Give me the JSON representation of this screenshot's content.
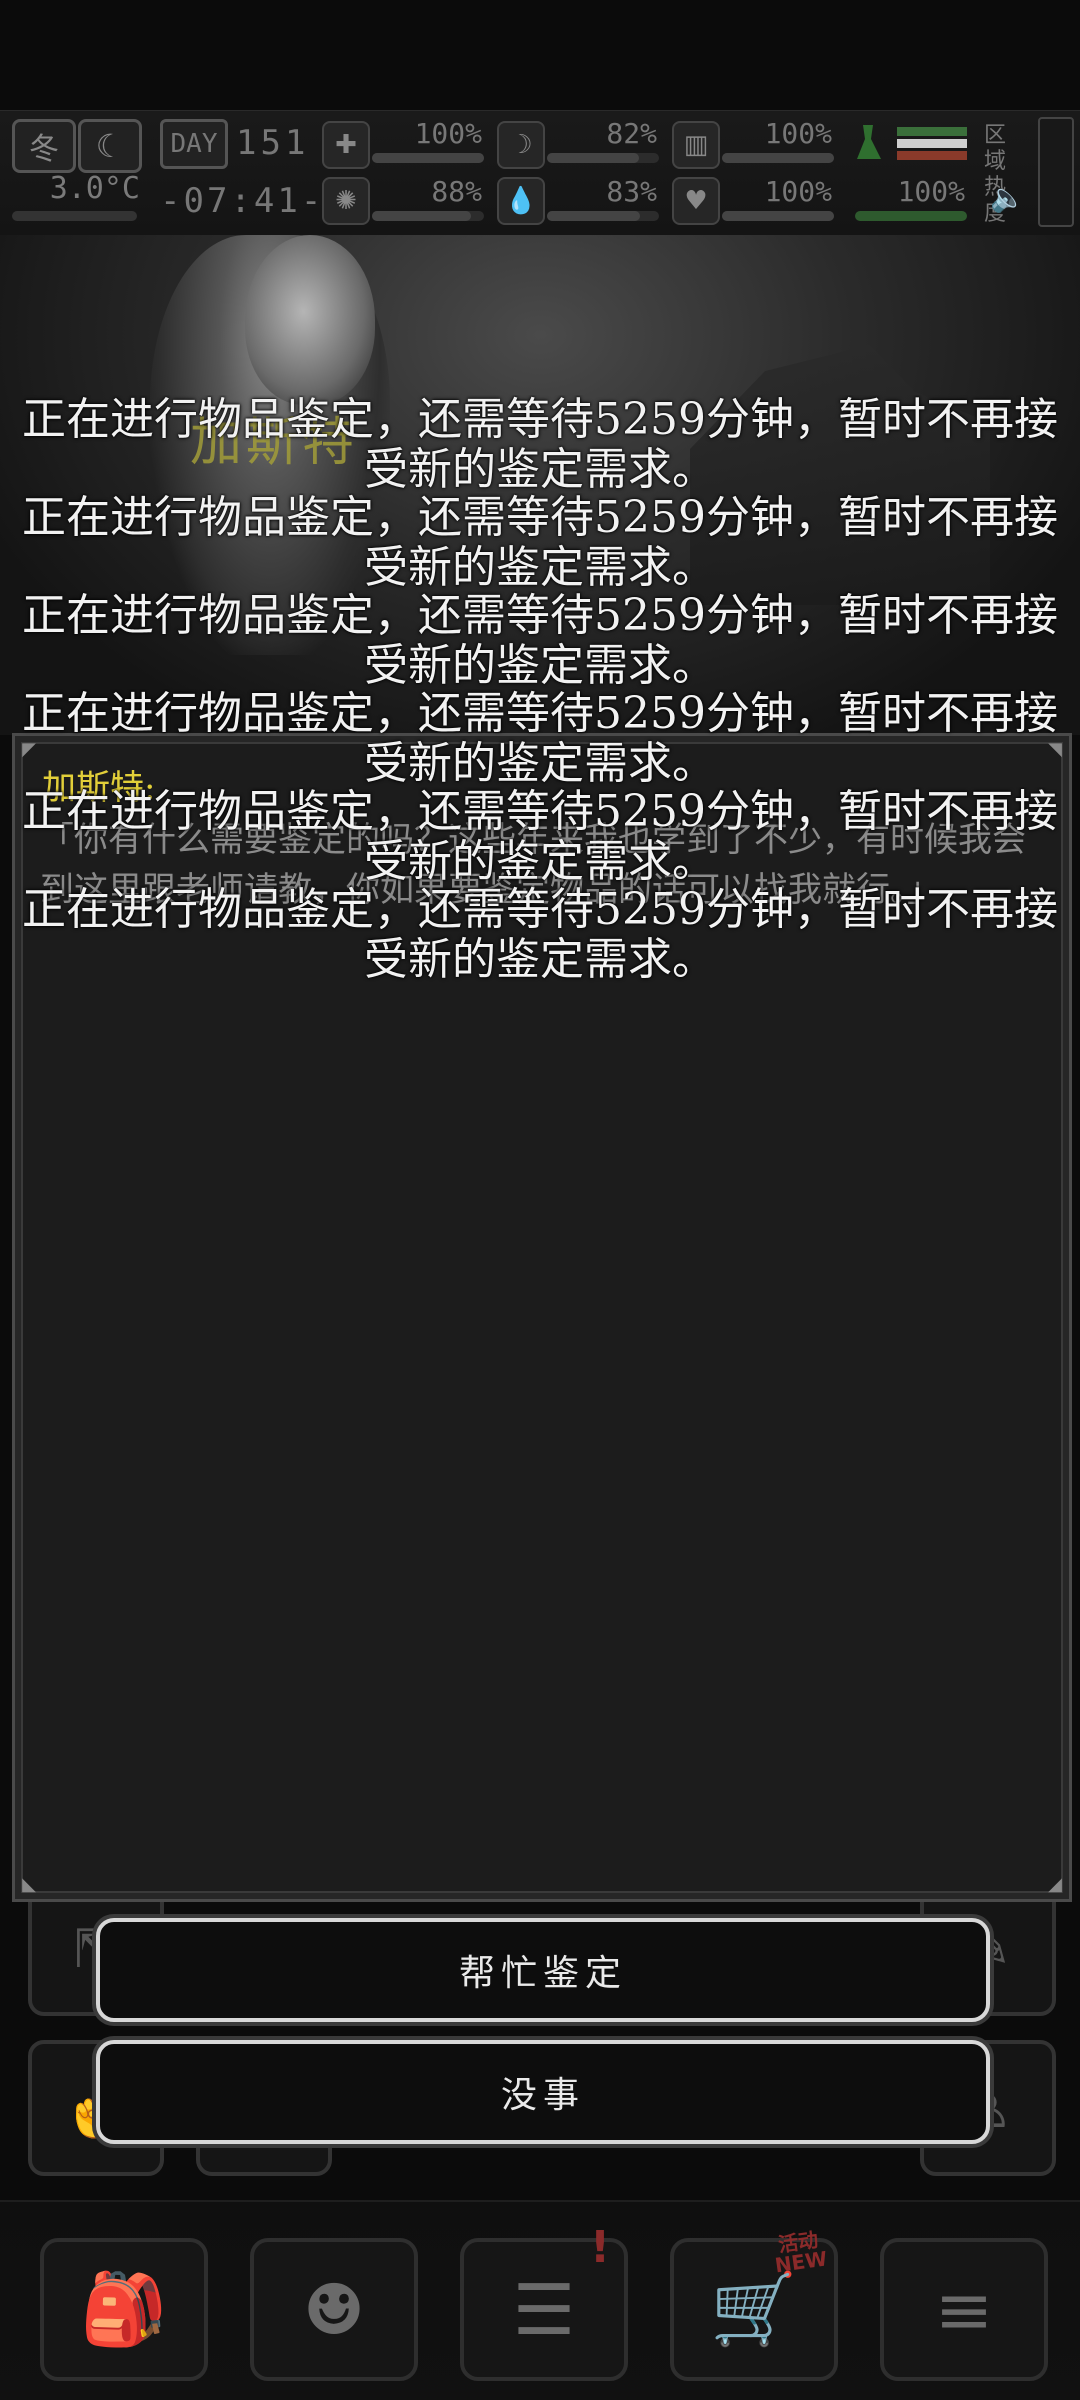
{
  "hud": {
    "season": "冬",
    "temperature": "3.0°C",
    "day_label": "DAY",
    "day_number": "151",
    "time": "-07:41-",
    "region_heat_label": "区域热度",
    "stats": [
      {
        "icon": "medkit-icon",
        "glyph": "✚",
        "value": "100%",
        "level": 1.0
      },
      {
        "icon": "stomach-icon",
        "glyph": "☽",
        "value": "82%",
        "level": 0.82
      },
      {
        "icon": "stamina-icon",
        "glyph": "▥",
        "value": "100%",
        "level": 1.0
      },
      {
        "icon": "brain-icon",
        "glyph": "✺",
        "value": "88%",
        "level": 0.88
      },
      {
        "icon": "water-drop-icon",
        "glyph": "💧",
        "value": "83%",
        "level": 0.83
      },
      {
        "icon": "heart-icon",
        "glyph": "♥",
        "value": "100%",
        "level": 1.0
      }
    ],
    "extra_value": "100%"
  },
  "npc": {
    "name": "加斯特"
  },
  "dialog": {
    "speaker": "加斯特:",
    "text": "「你有什么需要鉴定的吗？这些年来我也学到了不少，有时候我会到这里跟老师请教，你如果要鉴定物品的话可以找我就行。」"
  },
  "toasts": [
    "正在进行物品鉴定，还需等待5259分钟，暂时不再接受新的鉴定需求。",
    "正在进行物品鉴定，还需等待5259分钟，暂时不再接受新的鉴定需求。",
    "正在进行物品鉴定，还需等待5259分钟，暂时不再接受新的鉴定需求。",
    "正在进行物品鉴定，还需等待5259分钟，暂时不再接受新的鉴定需求。",
    "正在进行物品鉴定，还需等待5259分钟，暂时不再接受新的鉴定需求。",
    "正在进行物品鉴定，还需等待5259分钟，暂时不再接受新的鉴定需求。"
  ],
  "choices": {
    "appraise": "帮忙鉴定",
    "nothing": "没事"
  },
  "navbar": {
    "items": [
      {
        "icon": "backpack-icon",
        "glyph": "🎒"
      },
      {
        "icon": "brain-head-icon",
        "glyph": "☻"
      },
      {
        "icon": "notebook-icon",
        "glyph": "☰"
      },
      {
        "icon": "shopping-cart-icon",
        "glyph": "🛒"
      },
      {
        "icon": "menu-list-icon",
        "glyph": "≡"
      }
    ],
    "shop_badge": "活动 NEW",
    "notebook_badge": "!"
  }
}
